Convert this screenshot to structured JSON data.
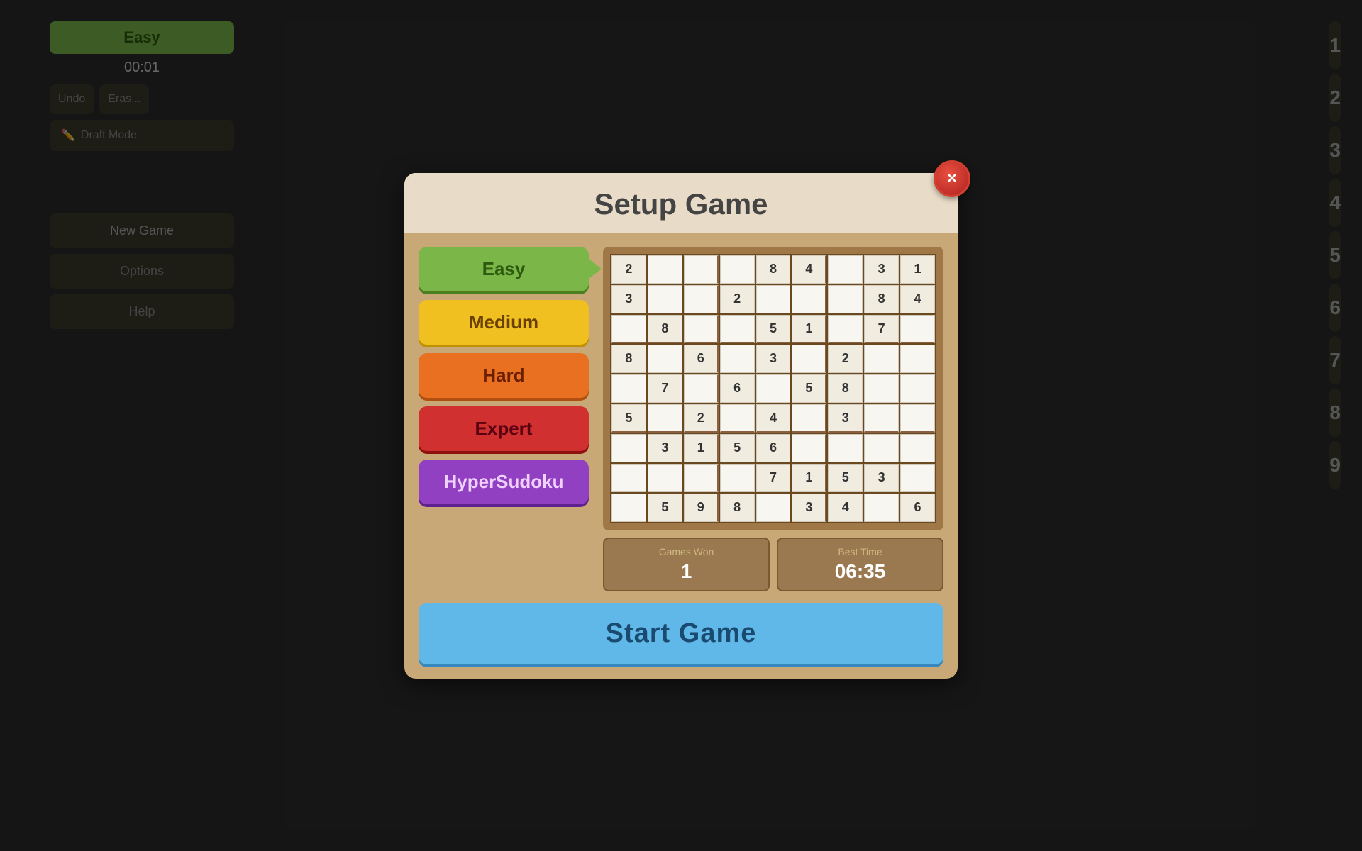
{
  "background": {
    "left_sidebar": {
      "difficulty": "Easy",
      "timer": "00:01",
      "undo_label": "Undo",
      "erase_label": "Eras...",
      "draft_mode_label": "Draft\nMode",
      "new_game_label": "New Game",
      "options_label": "Options",
      "help_label": "Help"
    },
    "right_pad": {
      "numbers": [
        "1",
        "2",
        "3",
        "4",
        "5",
        "6",
        "7",
        "8",
        "9"
      ]
    }
  },
  "modal": {
    "title": "Setup Game",
    "difficulty_options": [
      {
        "id": "easy",
        "label": "Easy",
        "selected": true
      },
      {
        "id": "medium",
        "label": "Medium",
        "selected": false
      },
      {
        "id": "hard",
        "label": "Hard",
        "selected": false
      },
      {
        "id": "expert",
        "label": "Expert",
        "selected": false
      },
      {
        "id": "hyper",
        "label": "HyperSudoku",
        "selected": false
      }
    ],
    "sudoku_grid": [
      [
        "2",
        "",
        "",
        "",
        "8",
        "4",
        "",
        "3",
        "1"
      ],
      [
        "3",
        "",
        "",
        "2",
        "",
        "",
        "",
        "8",
        "4"
      ],
      [
        "",
        "8",
        "",
        "",
        "5",
        "1",
        "",
        "7",
        ""
      ],
      [
        "8",
        "",
        "6",
        "",
        "3",
        "",
        "2",
        "",
        ""
      ],
      [
        "",
        "7",
        "",
        "6",
        "",
        "5",
        "8",
        "",
        ""
      ],
      [
        "5",
        "",
        "2",
        "",
        "4",
        "",
        "3",
        "",
        ""
      ],
      [
        "",
        "3",
        "1",
        "5",
        "6",
        "",
        "",
        "",
        ""
      ],
      [
        "",
        "",
        "",
        "",
        "7",
        "1",
        "5",
        "3",
        ""
      ],
      [
        "",
        "5",
        "9",
        "8",
        "",
        "3",
        "4",
        "",
        "6"
      ]
    ],
    "stats": {
      "games_won_label": "Games Won",
      "games_won_value": "1",
      "best_time_label": "Best Time",
      "best_time_value": "06:35"
    },
    "start_button_label": "Start Game",
    "close_button_label": "×"
  },
  "colors": {
    "easy_bg": "#7ab648",
    "medium_bg": "#f0c020",
    "hard_bg": "#e87020",
    "expert_bg": "#d03030",
    "hyper_bg": "#9040c0",
    "start_btn": "#60b8e8",
    "modal_bg": "#c8a876",
    "header_bg": "#e8dcc8"
  }
}
